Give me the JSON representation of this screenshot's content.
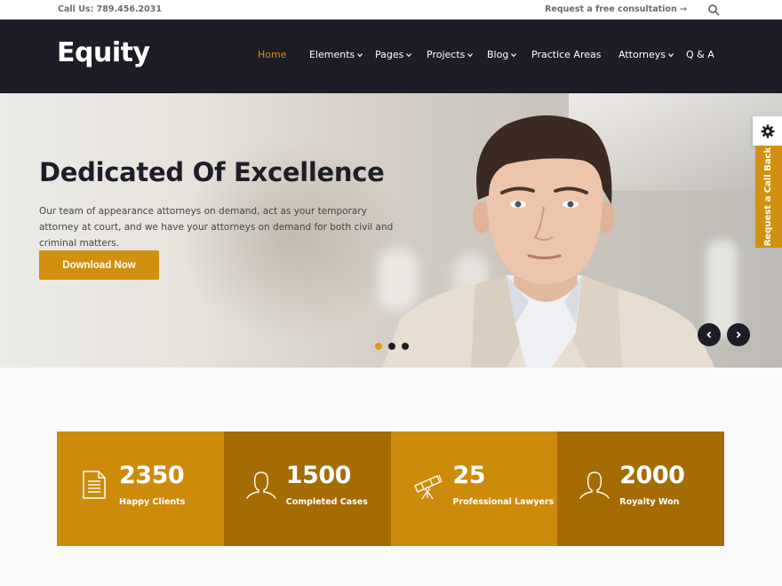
{
  "topbar": {
    "phone": "Call Us: 789.456.2031",
    "consultation_link": "Request a free consultation →",
    "search_icon": "search-icon"
  },
  "header": {
    "logo": "Equity",
    "nav": [
      {
        "label": "Home",
        "active": true,
        "dropdown": false
      },
      {
        "label": "Elements",
        "active": false,
        "dropdown": true
      },
      {
        "label": "Pages",
        "active": false,
        "dropdown": true
      },
      {
        "label": "Projects",
        "active": false,
        "dropdown": true
      },
      {
        "label": "Blog",
        "active": false,
        "dropdown": true
      },
      {
        "label": "Practice Areas",
        "active": false,
        "dropdown": false
      },
      {
        "label": "Attorneys",
        "active": false,
        "dropdown": true
      },
      {
        "label": "Q & A",
        "active": false,
        "dropdown": false
      }
    ]
  },
  "hero": {
    "title": "Dedicated Of Excellence",
    "text": "Our team of appearance attorneys on demand, act as your temporary attorney at court, and we have your attorneys on demand for both civil and criminal matters.",
    "button_label": "Download Now",
    "slides_total": 3,
    "active_slide": 1,
    "prev_icon": "chevron-left-icon",
    "next_icon": "chevron-right-icon"
  },
  "side_widget": {
    "settings_icon": "gear-icon",
    "callback_label": "Request a Call Back"
  },
  "stats": [
    {
      "value": "2350",
      "label": "Happy Clients",
      "icon": "document-icon"
    },
    {
      "value": "1500",
      "label": "Completed Cases",
      "icon": "person-icon"
    },
    {
      "value": "25",
      "label": "Professional Lawyers",
      "icon": "telescope-icon"
    },
    {
      "value": "2000",
      "label": "Royalty Won",
      "icon": "person-icon"
    }
  ],
  "colors": {
    "accent": "#d1900f",
    "header_bg": "#1d1c27",
    "stat_light": "#cd8b0b",
    "stat_dark": "#a56c03"
  }
}
